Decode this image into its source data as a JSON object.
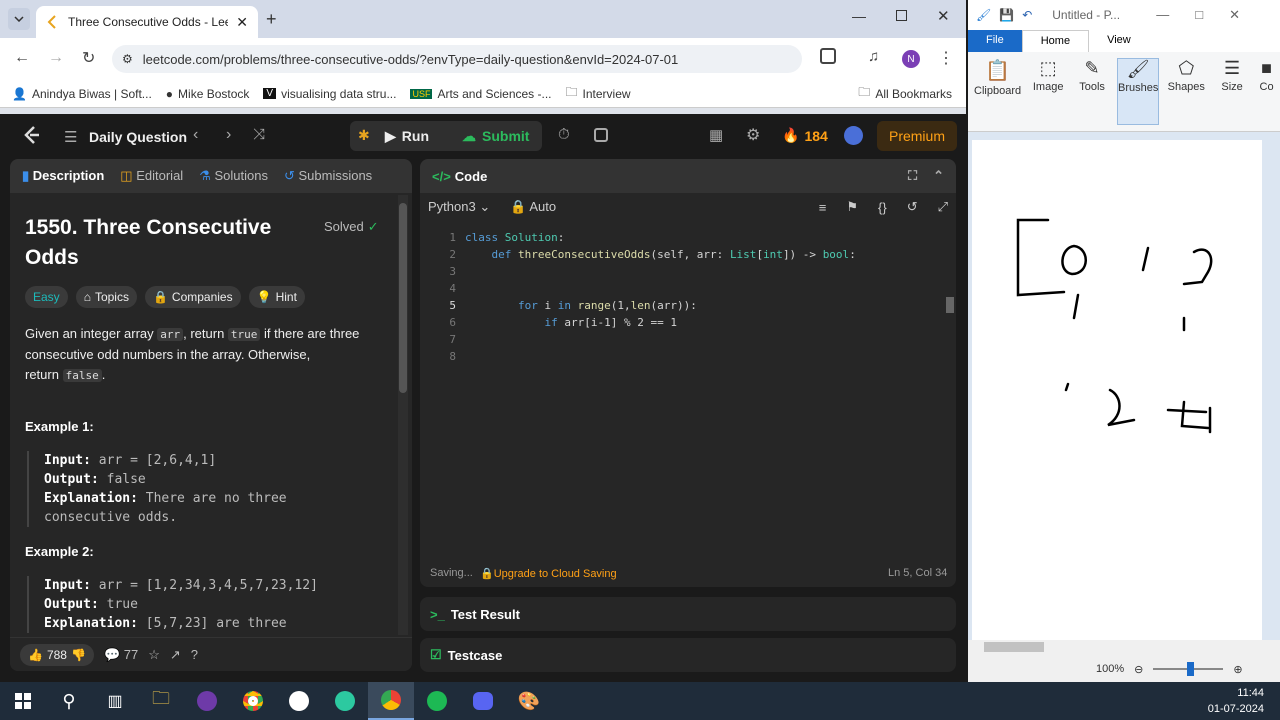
{
  "browser": {
    "tab_title": "Three Consecutive Odds - LeetC",
    "url": "leetcode.com/problems/three-consecutive-odds/?envType=daily-question&envId=2024-07-01",
    "bookmarks": [
      "Anindya Biwas | Soft...",
      "Mike Bostock",
      "visualising data stru...",
      "Arts and Sciences -...",
      "Interview"
    ],
    "all_bookmarks": "All Bookmarks",
    "profile_initial": "N"
  },
  "nav": {
    "daily": "Daily Question",
    "run": "Run",
    "submit": "Submit",
    "streak": "184",
    "premium": "Premium"
  },
  "left": {
    "tabs": [
      "Description",
      "Editorial",
      "Solutions",
      "Submissions"
    ],
    "title_line1": "1550. Three Consecutive",
    "title_line2": "Odds",
    "solved": "Solved",
    "difficulty": "Easy",
    "topics": "Topics",
    "companies": "Companies",
    "hint": "Hint",
    "desc_a": "Given an integer array ",
    "desc_arr": "arr",
    "desc_b": ", return ",
    "desc_true": "true",
    "desc_c": " if there are three",
    "desc_d": "consecutive odd numbers in the array. Otherwise,",
    "desc_e": "return ",
    "desc_false": "false",
    "desc_f": ".",
    "ex1_h": "Example 1:",
    "ex1_in_k": "Input:",
    "ex1_in": "arr = [2,6,4,1]",
    "ex1_out_k": "Output:",
    "ex1_out": "false",
    "ex1_exp_k": "Explanation:",
    "ex1_exp": "There are no three",
    "ex1_exp2": "consecutive odds.",
    "ex2_h": "Example 2:",
    "ex2_in_k": "Input:",
    "ex2_in": "arr = [1,2,34,3,4,5,7,23,12]",
    "ex2_out_k": "Output:",
    "ex2_out": "true",
    "ex2_exp_k": "Explanation:",
    "ex2_exp": "[5,7,23] are three",
    "likes": "788",
    "comments": "77"
  },
  "editor": {
    "title": "Code",
    "lang": "Python3",
    "auto": "Auto",
    "status_saving": "Saving...",
    "status_upgrade": "Upgrade to Cloud Saving",
    "cursor": "Ln 5, Col 34",
    "lines": [
      "1",
      "2",
      "3",
      "4",
      "5",
      "6",
      "7",
      "8"
    ]
  },
  "test_result": "Test Result",
  "testcase": "Testcase",
  "paint": {
    "title": "Untitled - P...",
    "tabs": [
      "File",
      "Home",
      "View"
    ],
    "tools": [
      "Clipboard",
      "Image",
      "Tools",
      "Brushes",
      "Shapes",
      "Size",
      "Co"
    ],
    "zoom": "100%"
  },
  "taskbar": {
    "time": "11:44",
    "date": "01-07-2024"
  }
}
